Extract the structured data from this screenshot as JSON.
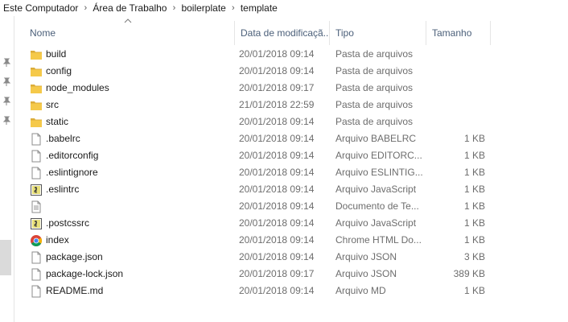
{
  "breadcrumb": [
    "Este Computador",
    "Área de Trabalho",
    "boilerplate",
    "template"
  ],
  "columns": {
    "name": "Nome",
    "date": "Data de modificaçã...",
    "type": "Tipo",
    "size": "Tamanho"
  },
  "files": [
    {
      "name": "build",
      "date": "20/01/2018 09:14",
      "type": "Pasta de arquivos",
      "size": "",
      "icon": "folder-icon"
    },
    {
      "name": "config",
      "date": "20/01/2018 09:14",
      "type": "Pasta de arquivos",
      "size": "",
      "icon": "folder-icon"
    },
    {
      "name": "node_modules",
      "date": "20/01/2018 09:17",
      "type": "Pasta de arquivos",
      "size": "",
      "icon": "folder-icon"
    },
    {
      "name": "src",
      "date": "21/01/2018 22:59",
      "type": "Pasta de arquivos",
      "size": "",
      "icon": "folder-icon"
    },
    {
      "name": "static",
      "date": "20/01/2018 09:14",
      "type": "Pasta de arquivos",
      "size": "",
      "icon": "folder-icon"
    },
    {
      "name": ".babelrc",
      "date": "20/01/2018 09:14",
      "type": "Arquivo BABELRC",
      "size": "1 KB",
      "icon": "file-icon"
    },
    {
      "name": ".editorconfig",
      "date": "20/01/2018 09:14",
      "type": "Arquivo EDITORC...",
      "size": "1 KB",
      "icon": "file-icon"
    },
    {
      "name": ".eslintignore",
      "date": "20/01/2018 09:14",
      "type": "Arquivo ESLINTIG...",
      "size": "1 KB",
      "icon": "file-icon"
    },
    {
      "name": ".eslintrc",
      "date": "20/01/2018 09:14",
      "type": "Arquivo JavaScript",
      "size": "1 KB",
      "icon": "javascript-file-icon"
    },
    {
      "name": "",
      "date": "20/01/2018 09:14",
      "type": "Documento de Te...",
      "size": "1 KB",
      "icon": "text-document-icon"
    },
    {
      "name": ".postcssrc",
      "date": "20/01/2018 09:14",
      "type": "Arquivo JavaScript",
      "size": "1 KB",
      "icon": "javascript-file-icon"
    },
    {
      "name": "index",
      "date": "20/01/2018 09:14",
      "type": "Chrome HTML Do...",
      "size": "1 KB",
      "icon": "chrome-icon"
    },
    {
      "name": "package.json",
      "date": "20/01/2018 09:14",
      "type": "Arquivo JSON",
      "size": "3 KB",
      "icon": "file-icon"
    },
    {
      "name": "package-lock.json",
      "date": "20/01/2018 09:17",
      "type": "Arquivo JSON",
      "size": "389 KB",
      "icon": "file-icon"
    },
    {
      "name": "README.md",
      "date": "20/01/2018 09:14",
      "type": "Arquivo MD",
      "size": "1 KB",
      "icon": "file-icon"
    }
  ],
  "colors": {
    "header_text": "#4c607a",
    "folder": "#f5c94a",
    "secondary_text": "#6d6d6d"
  }
}
